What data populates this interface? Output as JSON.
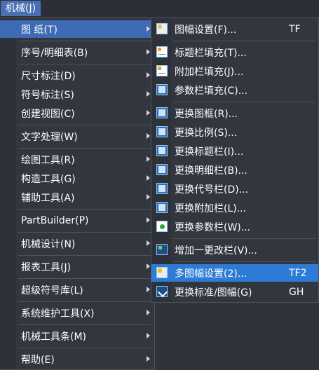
{
  "menubar": {
    "title": "机械(J)"
  },
  "left_menu": {
    "items": [
      {
        "label": "图    纸(T)",
        "arrow": true
      },
      {
        "label": "序号/明细表(B)",
        "arrow": true
      },
      {
        "label": "尺寸标注(D)",
        "arrow": true
      },
      {
        "label": "符号标注(S)",
        "arrow": true
      },
      {
        "label": "创建视图(C)",
        "arrow": true
      },
      {
        "label": "文字处理(W)",
        "arrow": true
      },
      {
        "label": "绘图工具(R)",
        "arrow": true
      },
      {
        "label": "构造工具(G)",
        "arrow": true
      },
      {
        "label": "辅助工具(A)",
        "arrow": true
      },
      {
        "label": "PartBuilder(P)",
        "arrow": true
      },
      {
        "label": "机械设计(N)",
        "arrow": true
      },
      {
        "label": "报表工具(J)",
        "arrow": true
      },
      {
        "label": "超级符号库(L)",
        "arrow": true
      },
      {
        "label": "系统维护工具(X)",
        "arrow": true
      },
      {
        "label": "机械工具条(M)",
        "arrow": true
      },
      {
        "label": "帮助(E)",
        "arrow": true
      }
    ]
  },
  "right_menu": {
    "items": [
      {
        "label": "图幅设置(F)...",
        "shortcut": "TF",
        "icon": "sheet-settings-icon"
      },
      {
        "label": "标题栏填充(T)...",
        "shortcut": "",
        "icon": "title-block-fill-icon"
      },
      {
        "label": "附加栏填充(J)...",
        "shortcut": "",
        "icon": "extra-block-fill-icon"
      },
      {
        "label": "参数栏填充(C)...",
        "shortcut": "",
        "icon": "param-block-fill-icon"
      },
      {
        "label": "更换图框(R)...",
        "shortcut": "",
        "icon": "replace-frame-icon"
      },
      {
        "label": "更换比例(S)...",
        "shortcut": "",
        "icon": "replace-scale-icon"
      },
      {
        "label": "更换标题栏(I)...",
        "shortcut": "",
        "icon": "replace-title-block-icon"
      },
      {
        "label": "更换明细栏(B)...",
        "shortcut": "",
        "icon": "replace-bom-icon"
      },
      {
        "label": "更换代号栏(D)...",
        "shortcut": "",
        "icon": "replace-code-block-icon"
      },
      {
        "label": "更换附加栏(L)...",
        "shortcut": "",
        "icon": "replace-extra-block-icon"
      },
      {
        "label": "更换参数栏(W)...",
        "shortcut": "",
        "icon": "replace-param-block-icon"
      },
      {
        "label": "增加一更改栏(V)...",
        "shortcut": "",
        "icon": "add-change-block-icon"
      },
      {
        "label": "多图幅设置(2)...",
        "shortcut": "TF2",
        "icon": "multi-sheet-settings-icon"
      },
      {
        "label": "更换标准/图幅(G)",
        "shortcut": "GH",
        "icon": "replace-standard-icon"
      }
    ]
  }
}
